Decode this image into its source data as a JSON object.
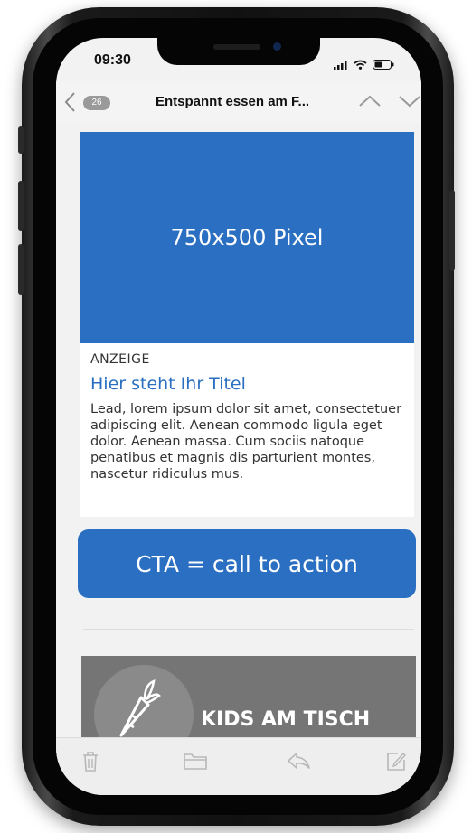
{
  "status_bar": {
    "time": "09:30",
    "icons": [
      "signal-icon",
      "wifi-icon",
      "battery-icon"
    ]
  },
  "nav_bar": {
    "unread_count": "26",
    "title": "Entspannt essen am F...",
    "icons": [
      "back-chevron-icon",
      "previous-mail-icon",
      "next-mail-icon"
    ]
  },
  "ad": {
    "image_label": "750x500 Pixel",
    "badge": "ANZEIGE",
    "title": "Hier steht Ihr Titel",
    "body": "Lead, lorem ipsum dolor sit amet, consectetuer adipiscing elit. Aenean commodo ligula eget dolor. Aenean massa. Cum sociis natoque penatibus et magnis dis parturient montes, nascetur ridiculus mus."
  },
  "cta": {
    "label": "CTA = call to action"
  },
  "promo": {
    "text": "KIDS AM TISCH"
  },
  "toolbar": {
    "icons": [
      "trash-icon",
      "folder-icon",
      "reply-icon",
      "compose-icon"
    ]
  },
  "colors": {
    "accent": "#2a6fc1",
    "screen_bg": "#f2f2f2",
    "promo_bg": "#757575"
  }
}
